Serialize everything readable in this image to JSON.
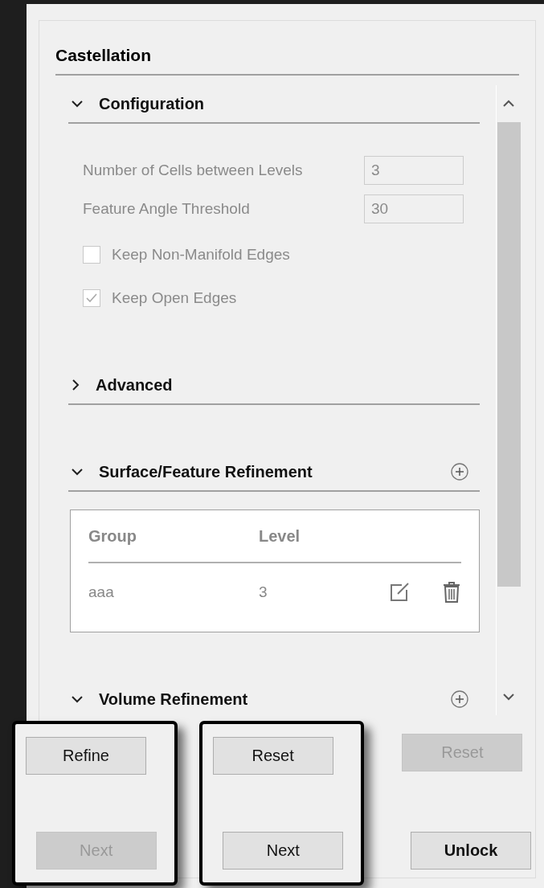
{
  "panel": {
    "title": "Castellation"
  },
  "sections": [
    {
      "kind": "form",
      "title": "Configuration",
      "expanded": true,
      "addable": false,
      "fields": [
        {
          "label": "Number of Cells between Levels",
          "value": "3",
          "disabled": true
        },
        {
          "label": "Feature Angle Threshold",
          "value": "30",
          "disabled": true
        }
      ],
      "checkboxes": [
        {
          "label": "Keep Non-Manifold Edges",
          "checked": false,
          "disabled": true
        },
        {
          "label": "Keep Open Edges",
          "checked": true,
          "disabled": true
        }
      ]
    },
    {
      "title": "Advanced",
      "expanded": false,
      "addable": false
    },
    {
      "kind": "table",
      "title": "Surface/Feature Refinement",
      "expanded": true,
      "addable": true,
      "columns": [
        "Group",
        "Level"
      ],
      "rows": [
        {
          "cells": [
            "aaa",
            "3"
          ]
        }
      ]
    },
    {
      "kind": "table",
      "title": "Volume Refinement",
      "expanded": true,
      "addable": true
    }
  ],
  "footer": [
    {
      "highlighted": true,
      "buttons": [
        {
          "label": "Refine",
          "disabled": false,
          "emphasized": false
        },
        {
          "label": "Next",
          "disabled": true,
          "emphasized": false
        }
      ]
    },
    {
      "highlighted": true,
      "buttons": [
        {
          "label": "Reset",
          "disabled": false,
          "emphasized": false
        },
        {
          "label": "Next",
          "disabled": false,
          "emphasized": false
        }
      ]
    },
    {
      "highlighted": false,
      "buttons": [
        {
          "label": "Reset",
          "disabled": true,
          "emphasized": false
        },
        {
          "label": "Unlock",
          "disabled": false,
          "emphasized": true
        }
      ]
    }
  ]
}
